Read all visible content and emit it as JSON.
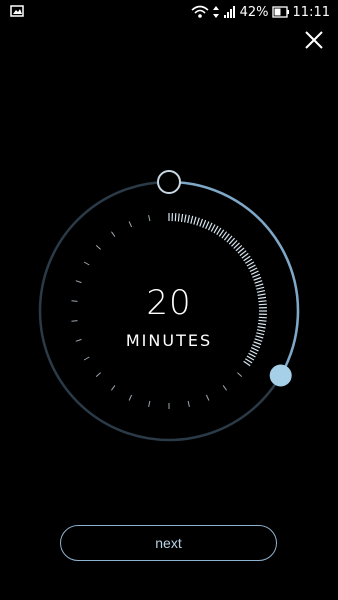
{
  "status_bar": {
    "battery": "42%",
    "time": "11:11",
    "icons": [
      "image-icon",
      "wifi-icon",
      "data-arrows-icon",
      "signal-icon",
      "battery-icon"
    ]
  },
  "close": {
    "icon": "close-icon"
  },
  "timer": {
    "value": "20",
    "unit": "MINUTES",
    "selected_minutes": 20,
    "accent_color": "#7fa8c8",
    "handle_color": "#a6cfe8",
    "track_color": "#2b3a47"
  },
  "next_button": {
    "label": "next"
  }
}
